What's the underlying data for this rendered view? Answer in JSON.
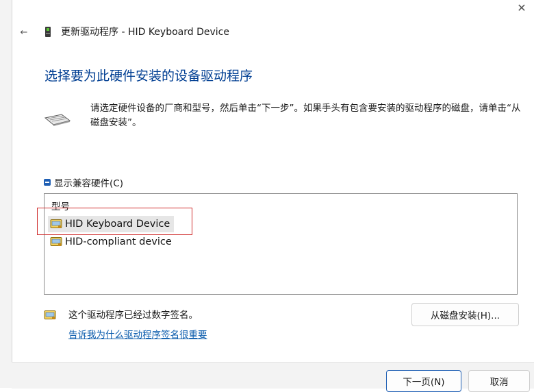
{
  "window": {
    "close_glyph": "✕",
    "back_glyph": "←",
    "wizard_title": "更新驱动程序 - HID Keyboard Device"
  },
  "main": {
    "heading": "选择要为此硬件安装的设备驱动程序",
    "instruction": "请选定硬件设备的厂商和型号，然后单击“下一步”。如果手头有包含要安装的驱动程序的磁盘，请单击“从磁盘安装”。",
    "show_compatible_label": "显示兼容硬件(C)",
    "show_compatible_checked": true,
    "list": {
      "header": "型号",
      "items": [
        {
          "label": "HID Keyboard Device",
          "selected": true
        },
        {
          "label": "HID-compliant device",
          "selected": false
        }
      ]
    },
    "signature_text": "这个驱动程序已经过数字签名。",
    "signature_link": "告诉我为什么驱动程序签名很重要",
    "have_disk_button": "从磁盘安装(H)..."
  },
  "footer": {
    "next_button": "下一页(N)",
    "cancel_button": "取消"
  },
  "colors": {
    "heading": "#003e92",
    "link": "#0b5cad",
    "accent": "#1f5fb4",
    "highlight": "#cf2b2b"
  },
  "icons": {
    "wizard": "device-wizard-icon",
    "keyboard": "keyboard-icon",
    "driver": "driver-device-icon",
    "certificate": "certificate-icon"
  }
}
